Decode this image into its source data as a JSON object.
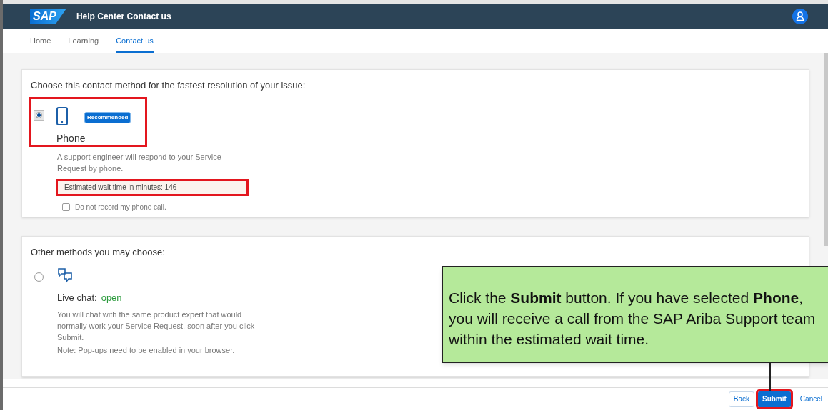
{
  "header": {
    "logo": "SAP",
    "title": "Help Center Contact us"
  },
  "tabs": [
    {
      "label": "Home",
      "selected": false
    },
    {
      "label": "Learning",
      "selected": false
    },
    {
      "label": "Contact us",
      "selected": true
    }
  ],
  "primary_section": {
    "heading": "Choose this contact method for the fastest resolution of your issue:",
    "option": {
      "selected": true,
      "label": "Phone",
      "badge": "Recommended",
      "description": "A support engineer will respond to your Service Request by phone.",
      "wait_time": "Estimated wait time in minutes: 146",
      "checkbox": {
        "label": "Do not record my phone call.",
        "checked": false
      }
    }
  },
  "other_section": {
    "heading": "Other methods you may choose:",
    "option": {
      "selected": false,
      "label": "Live chat:",
      "status": "open",
      "description": "You will chat with the same product expert that would normally work your Service Request, soon after you click Submit.",
      "note": "Note: Pop-ups need to be enabled in your browser."
    }
  },
  "footer": {
    "buttons": [
      {
        "label": "Back",
        "kind": "secondary"
      },
      {
        "label": "Submit",
        "kind": "primary"
      },
      {
        "label": "Cancel",
        "kind": "link"
      }
    ]
  },
  "callout": {
    "text": "Click the **Submit** button. If you have selected **Phone**, you will receive a call from the SAP Ariba Support team within the estimated wait time."
  }
}
